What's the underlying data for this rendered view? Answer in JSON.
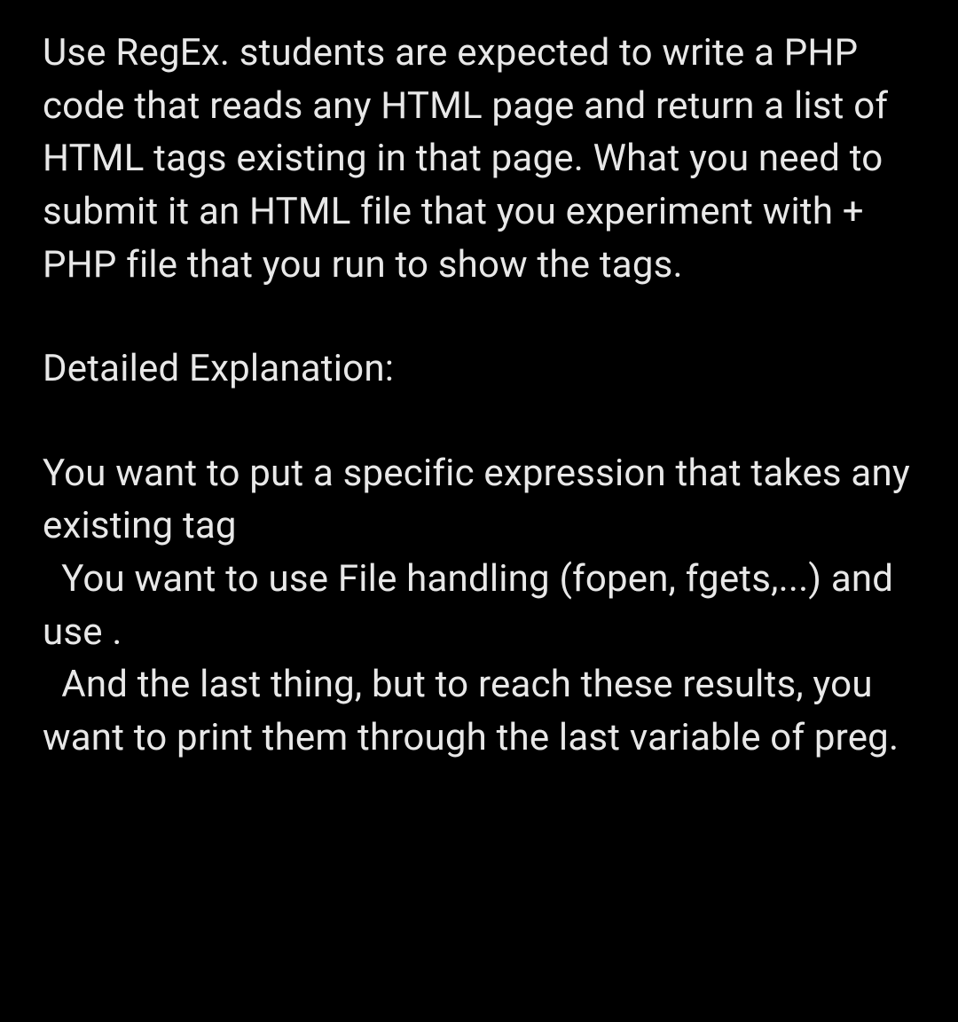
{
  "paragraphs": {
    "intro": "Use RegEx. students are expected to write a PHP code that reads any HTML page and return a list of HTML tags existing in that page. What you need to submit it an HTML file that you experiment with + PHP file that you run to show the tags.",
    "heading": "Detailed Explanation:",
    "detail": "You want to put a specific expression that takes any existing tag\n  You want to use File handling (fopen, fgets,...) and use .\n  And the last thing, but to reach these results, you want to print them through the last variable of preg."
  }
}
